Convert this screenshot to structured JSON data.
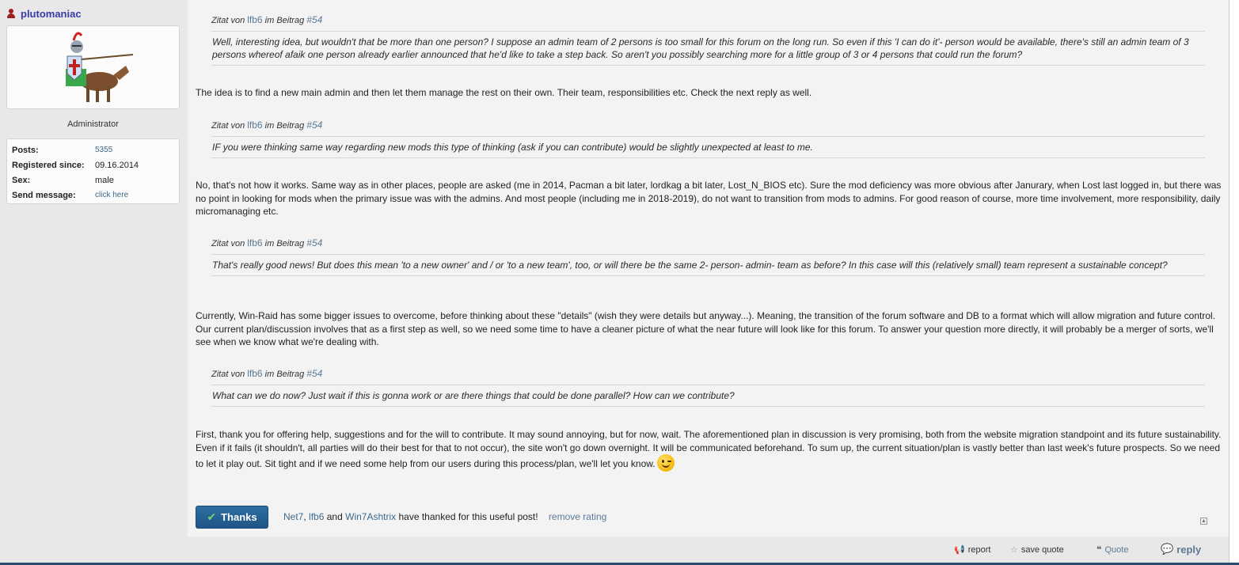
{
  "user": {
    "name": "plutomaniac",
    "role": "Administrator",
    "info": [
      {
        "label": "Posts:",
        "value": "5355",
        "link": true
      },
      {
        "label": "Registered since:",
        "value": "09.16.2014",
        "link": false
      },
      {
        "label": "Sex:",
        "value": "male",
        "link": false
      },
      {
        "label": "Send message:",
        "value": "click here",
        "link": true
      }
    ]
  },
  "quote_meta": {
    "prefix": "Zitat von",
    "author": "lfb6",
    "in_post": "im Beitrag",
    "post_ref": "#54"
  },
  "quotes": [
    "Well, interesting idea, but wouldn't that be more than one person? I suppose an admin team of 2 persons is too small for this forum on the long run. So even if this 'I can do it'- person would be available, there's still an admin team of 3 persons whereof afaik one person already earlier announced that he'd like to take a step back. So aren't you possibly searching more for a little group of 3 or 4 persons that could run the forum?",
    "IF you were thinking same way regarding new mods this type of thinking (ask if you can contribute) would be slightly unexpected at least to me.",
    "That's really good news! But does this mean 'to a new owner' and / or 'to a new team', too, or will there be the same 2- person- admin- team as before? In this case will this (relatively small) team represent a sustainable concept?",
    "What can we do now? Just wait if this is gonna work or are there things that could be done parallel? How can we contribute?"
  ],
  "replies": [
    "The idea is to find a new main admin and then let them manage the rest on their own. Their team, responsibilities etc. Check the next reply as well.",
    "No, that's not how it works. Same way as in other places, people are asked (me in 2014, Pacman a bit later, lordkag a bit later, Lost_N_BIOS etc). Sure the mod deficiency was more obvious after Janurary, when Lost last logged in, but there was no point in looking for mods when the primary issue was with the admins. And most people (including me in 2018-2019), do not want to transition from mods to admins. For good reason of course, more time involvement, more responsibility, daily micromanaging etc.",
    "Currently, Win-Raid has some bigger issues to overcome, before thinking about these \"details\" (wish they were details but anyway...). Meaning, the transition of the forum software and DB to a format which will allow migration and future control. Our current plan/discussion involves that as a first step as well, so we need some time to have a cleaner picture of what the near future will look like for this forum. To answer your question more directly, it will probably be a merger of sorts, we'll see when we know what we're dealing with.",
    "First, thank you for offering help, suggestions and for the will to contribute. It may sound annoying, but for now, wait. The aforementioned plan in discussion is very promising, both from the website migration standpoint and its future sustainability. Even if it fails (it shouldn't, all parties will do their best for that to not occur), the site won't go down overnight. It will be communicated beforehand. To sum up, the current situation/plan is vastly better than last week's future prospects. So we need to let it play out. Sit tight and if we need some help from our users during this process/plan, we'll let you know."
  ],
  "thanks": {
    "button_label": "Thanks",
    "users": [
      "Net7",
      "lfb6",
      "Win7Ashtrix"
    ],
    "sep1": ",",
    "and": "and",
    "suffix": "have thanked for this useful post!",
    "remove": "remove rating"
  },
  "footer": {
    "report": "report",
    "save_quote": "save quote",
    "quote": "Quote",
    "reply": "reply"
  }
}
